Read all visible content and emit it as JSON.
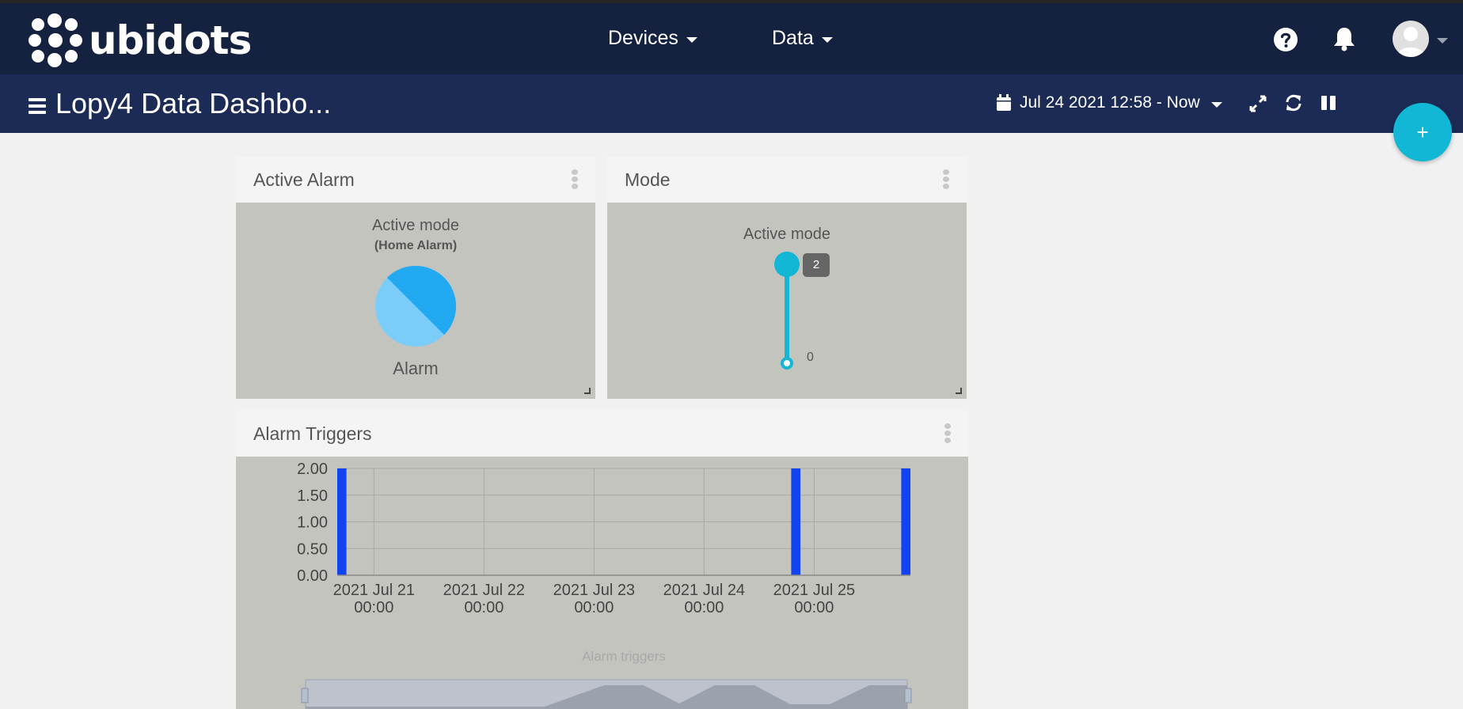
{
  "brand": {
    "name": "ubidots"
  },
  "nav": {
    "devices_label": "Devices",
    "data_label": "Data"
  },
  "dashboard": {
    "title": "Lopy4 Data Dashbo...",
    "date_range": "Jul 24 2021 12:58 - Now"
  },
  "fab": {
    "label": "+"
  },
  "widgets": {
    "active_alarm": {
      "title": "Active Alarm",
      "caption": "Active mode",
      "subcaption": "(Home Alarm)",
      "state_label": "Alarm"
    },
    "mode": {
      "title": "Mode",
      "caption": "Active mode",
      "value_badge": "2",
      "min_label": "0",
      "value": 2,
      "min": 0,
      "max": 2
    },
    "alarm_triggers": {
      "title": "Alarm Triggers",
      "series_label": "Alarm triggers"
    }
  },
  "colors": {
    "topbar": "#14213f",
    "subbar": "#1b2b55",
    "accent": "#12b7d5",
    "bar": "#1144f0",
    "widget_bg": "#c4c4bf",
    "pie_dark": "#21a9f2",
    "pie_light": "#7bcdf9"
  },
  "chart_data": {
    "type": "bar",
    "title": "",
    "ylabel": "",
    "xlabel": "Alarm triggers",
    "ylim": [
      0,
      2
    ],
    "y_ticks": [
      "0.00",
      "0.50",
      "1.00",
      "1.50",
      "2.00"
    ],
    "x_ticks": [
      {
        "line1": "2021 Jul 21",
        "line2": "00:00"
      },
      {
        "line1": "2021 Jul 22",
        "line2": "00:00"
      },
      {
        "line1": "2021 Jul 23",
        "line2": "00:00"
      },
      {
        "line1": "2021 Jul 24",
        "line2": "00:00"
      },
      {
        "line1": "2021 Jul 25",
        "line2": "00:00"
      }
    ],
    "x_start": "2021-07-20 16:00",
    "x_end": "2021-07-25 21:00",
    "bars": [
      {
        "start": "2021-07-20 16:00",
        "end": "2021-07-20 18:00",
        "value": 2
      },
      {
        "start": "2021-07-24 19:00",
        "end": "2021-07-24 21:00",
        "value": 2
      },
      {
        "start": "2021-07-25 19:00",
        "end": "2021-07-25 21:00",
        "value": 2
      }
    ],
    "grid": true,
    "legend": "none"
  }
}
